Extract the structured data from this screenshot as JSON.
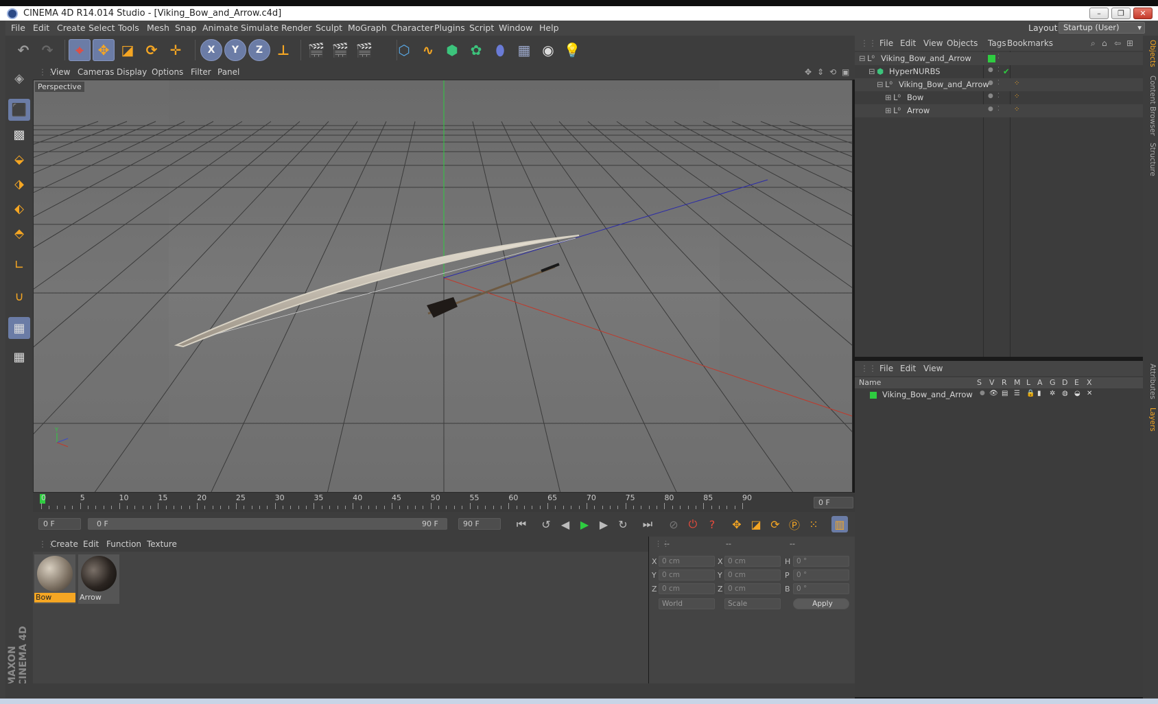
{
  "window": {
    "title": "CINEMA 4D R14.014 Studio - [Viking_Bow_and_Arrow.c4d]",
    "minimize": "–",
    "restore": "❐",
    "close": "✕"
  },
  "menubar": {
    "items": [
      "File",
      "Edit",
      "Create",
      "Select",
      "Tools",
      "Mesh",
      "Snap",
      "Animate",
      "Simulate",
      "Render",
      "Sculpt",
      "MoGraph",
      "Character",
      "Plugins",
      "Script",
      "Window",
      "Help"
    ],
    "layout_label": "Layout:",
    "layout_value": "Startup (User)"
  },
  "toolbar": {
    "axis_x": "X",
    "axis_y": "Y",
    "axis_z": "Z"
  },
  "viewport": {
    "menu": [
      "View",
      "Cameras",
      "Display",
      "Options",
      "Filter",
      "Panel"
    ],
    "label": "Perspective",
    "grid_color": "#3a3a3a",
    "axis_x_color": "#c0392b",
    "axis_y_color": "#2ecc40",
    "axis_z_color": "#2a2aa8"
  },
  "timeline": {
    "ticks": [
      "0",
      "5",
      "10",
      "15",
      "20",
      "25",
      "30",
      "35",
      "40",
      "45",
      "50",
      "55",
      "60",
      "65",
      "70",
      "75",
      "80",
      "85",
      "90"
    ],
    "current_frame": "0 F",
    "start_frame": "0 F",
    "range_start": "0 F",
    "range_end": "90 F",
    "end_frame": "90 F"
  },
  "materials": {
    "menu": [
      "Create",
      "Edit",
      "Function",
      "Texture"
    ],
    "items": [
      {
        "name": "Bow",
        "selected": true
      },
      {
        "name": "Arrow",
        "selected": false
      }
    ]
  },
  "coordinates": {
    "headers": [
      "--",
      "--",
      "--"
    ],
    "pos": [
      {
        "axis": "X",
        "value": "0 cm"
      },
      {
        "axis": "Y",
        "value": "0 cm"
      },
      {
        "axis": "Z",
        "value": "0 cm"
      }
    ],
    "size": [
      {
        "axis": "X",
        "value": "0 cm"
      },
      {
        "axis": "Y",
        "value": "0 cm"
      },
      {
        "axis": "Z",
        "value": "0 cm"
      }
    ],
    "rot": [
      {
        "axis": "H",
        "value": "0 °"
      },
      {
        "axis": "P",
        "value": "0 °"
      },
      {
        "axis": "B",
        "value": "0 °"
      }
    ],
    "mode1": "World",
    "mode2": "Scale",
    "apply": "Apply"
  },
  "object_manager": {
    "menu": [
      "File",
      "Edit",
      "View",
      "Objects",
      "Tags",
      "Bookmarks"
    ],
    "rows": [
      {
        "name": "Viking_Bow_and_Arrow",
        "indent": 0
      },
      {
        "name": "HyperNURBS",
        "indent": 1
      },
      {
        "name": "Viking_Bow_and_Arrow",
        "indent": 2
      },
      {
        "name": "Bow",
        "indent": 3
      },
      {
        "name": "Arrow",
        "indent": 3
      }
    ]
  },
  "layer_manager": {
    "menu": [
      "File",
      "Edit",
      "View"
    ],
    "columns": [
      "Name",
      "S",
      "V",
      "R",
      "M",
      "L",
      "A",
      "G",
      "D",
      "E",
      "X"
    ],
    "rows": [
      {
        "name": "Viking_Bow_and_Arrow",
        "color": "#2ecc40"
      }
    ]
  },
  "right_tabs": {
    "top": [
      "Objects",
      "Content Browser",
      "Structure"
    ],
    "bottom": [
      "Attributes",
      "Layers"
    ]
  },
  "brand": "MAXON CINEMA 4D"
}
